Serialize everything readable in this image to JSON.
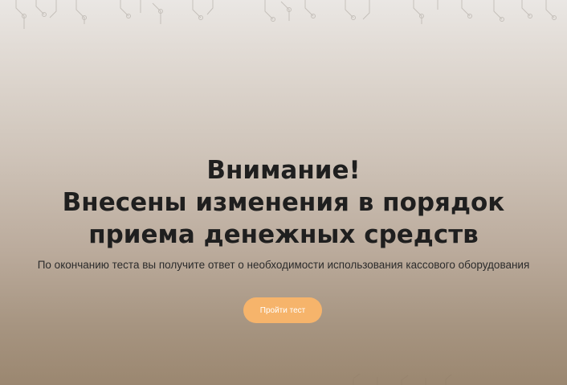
{
  "hero": {
    "headline_line1": "Внимание!",
    "headline_line2": "Внесены изменения в порядок",
    "headline_line3": "приема денежных средств",
    "subtitle": "По окончанию теста вы получите ответ о необходимости использования кассового оборудования"
  },
  "cta": {
    "label": "Пройти тест",
    "color": "#f6b46b"
  },
  "decor": {
    "pattern_icon": "circuit-pattern-icon"
  }
}
